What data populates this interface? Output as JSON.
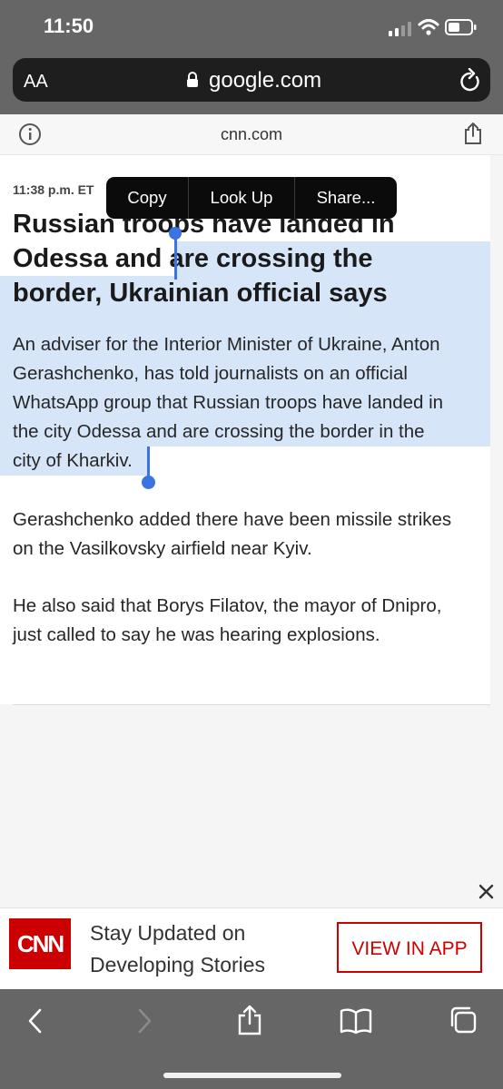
{
  "status": {
    "time": "11:50"
  },
  "browser": {
    "text_size_label": "AA",
    "domain": "google.com"
  },
  "site": {
    "domain": "cnn.com"
  },
  "context_menu": {
    "items": [
      "Copy",
      "Look Up",
      "Share..."
    ]
  },
  "article": {
    "timestamp": "11:38 p.m. ET",
    "headline_lines": [
      "Russian troops have landed in",
      "Odessa and are crossing the",
      "border, Ukrainian official says"
    ],
    "p1_lines": [
      "An adviser for the Interior Minister of Ukraine, Anton",
      "Gerashchenko, has told journalists on an official",
      "WhatsApp group that Russian troops have landed in",
      "the city Odessa and are crossing the border in the",
      "city of Kharkiv."
    ],
    "p2_lines": [
      "Gerashchenko added there have been missile strikes",
      "on the Vasilkovsky airfield near Kyiv."
    ],
    "p3_lines": [
      "He also said that Borys Filatov, the mayor of Dnipro,",
      "just called to say he was hearing explosions."
    ]
  },
  "banner": {
    "logo_text": "CNN",
    "message_lines": [
      "Stay Updated on",
      "Developing Stories"
    ],
    "button_label": "VIEW IN APP"
  },
  "colors": {
    "cnn_red": "#cc0000",
    "selection": "#6ea0eb",
    "chrome": "#666666"
  },
  "icons": [
    "signal-icon",
    "wifi-icon",
    "battery-icon",
    "lock-icon",
    "reload-icon",
    "info-icon",
    "share-icon",
    "close-icon",
    "back-icon",
    "forward-icon",
    "bookmarks-icon",
    "tabs-icon"
  ]
}
